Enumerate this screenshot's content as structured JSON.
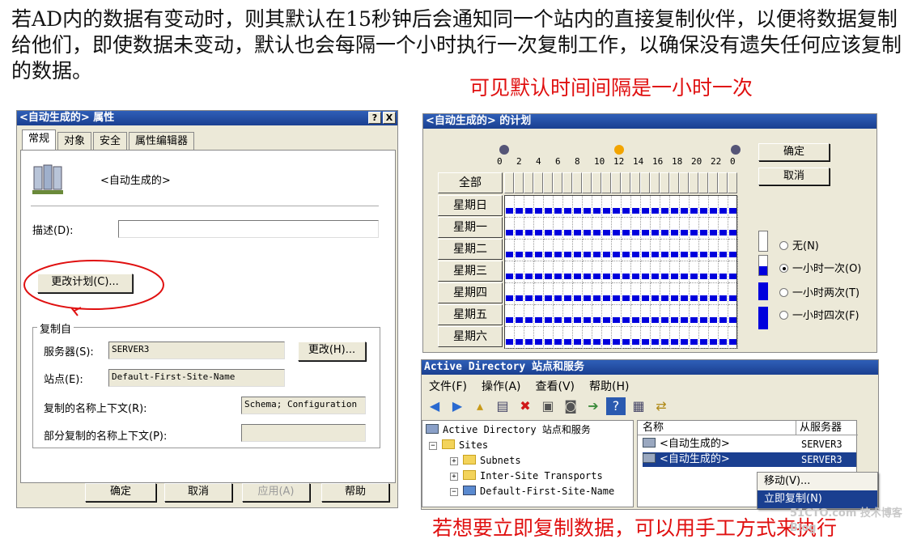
{
  "intro_text": "若AD内的数据有变动时，则其默认在15秒钟后会通知同一个站内的直接复制伙伴，以便将数据复制给他们，即使数据未变动，默认也会每隔一个小时执行一次复制工作，以确保没有遗失任何应该复制的数据。",
  "note_top": "可见默认时间间隔是一小时一次",
  "note_bottom": "若想要立即复制数据，可以用手工方式来执行",
  "watermark": "51CTO.com 技术博客 Blog",
  "colors": {
    "annotation": "#e01010",
    "schedule_fill": "#0000dd",
    "titlebar": "#1a3f90"
  },
  "props": {
    "title": "<自动生成的> 属性",
    "help_btn": "?",
    "close_btn": "X",
    "tabs": [
      "常规",
      "对象",
      "安全",
      "属性编辑器"
    ],
    "object_name": "<自动生成的>",
    "desc_label": "描述(D):",
    "desc_value": "",
    "change_schedule": "更改计划(C)...",
    "group_title": "复制自",
    "server_label": "服务器(S):",
    "server_value": "SERVER3",
    "change_btn": "更改(H)...",
    "site_label": "站点(E):",
    "site_value": "Default-First-Site-Name",
    "nc_label": "复制的名称上下文(R):",
    "nc_value": "Schema; Configuration",
    "partial_label": "部分复制的名称上下文(P):",
    "partial_value": "",
    "ok": "确定",
    "cancel": "取消",
    "apply": "应用(A)",
    "help": "帮助"
  },
  "schedule": {
    "title": "<自动生成的> 的计划",
    "hour_labels": [
      "0",
      "2",
      "4",
      "6",
      "8",
      "10",
      "12",
      "14",
      "16",
      "18",
      "20",
      "22",
      "0"
    ],
    "all": "全部",
    "days": [
      "星期日",
      "星期一",
      "星期二",
      "星期三",
      "星期四",
      "星期五",
      "星期六"
    ],
    "ok": "确定",
    "cancel": "取消",
    "options": [
      "无(N)",
      "一小时一次(O)",
      "一小时两次(T)",
      "一小时四次(F)"
    ],
    "selected_option": "一小时一次(O)"
  },
  "ad": {
    "title": "Active Directory 站点和服务",
    "menus": [
      "文件(F)",
      "操作(A)",
      "查看(V)",
      "帮助(H)"
    ],
    "toolbar_icons": [
      "back-icon",
      "forward-icon",
      "up-folder-icon",
      "show-tree-icon",
      "delete-icon",
      "properties-icon",
      "refresh-icon",
      "export-icon",
      "help-icon",
      "console-icon",
      "replicate-icon"
    ],
    "tree": [
      {
        "label": "Active Directory 站点和服务",
        "level": 0
      },
      {
        "label": "Sites",
        "level": 1
      },
      {
        "label": "Subnets",
        "level": 2
      },
      {
        "label": "Inter-Site Transports",
        "level": 2
      },
      {
        "label": "Default-First-Site-Name",
        "level": 2
      }
    ],
    "col_name": "名称",
    "col_from": "从服务器",
    "rows": [
      {
        "name": "<自动生成的>",
        "from": "SERVER3"
      },
      {
        "name": "<自动生成的>",
        "from": "SERVER3"
      }
    ],
    "context_menu": [
      "移动(V)...",
      "立即复制(N)"
    ]
  }
}
